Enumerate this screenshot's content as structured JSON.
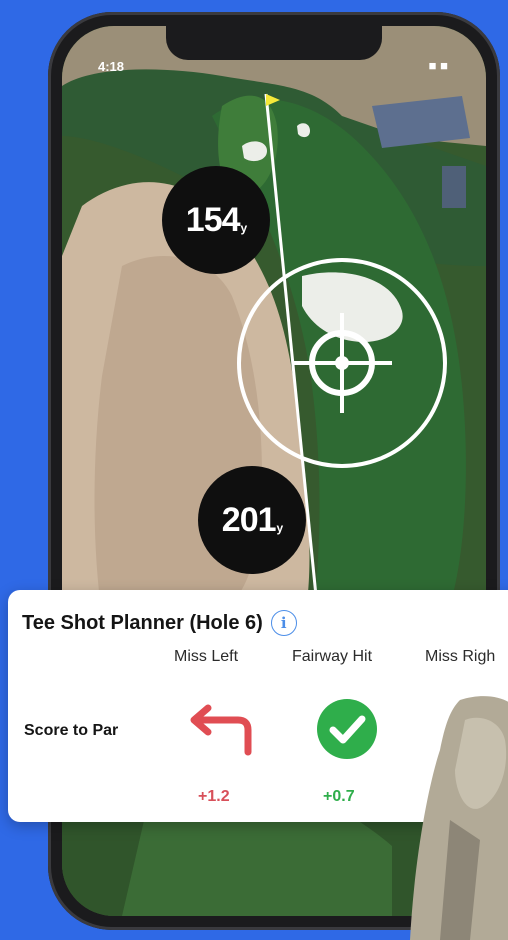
{
  "status_bar": {
    "time": "4:18",
    "icons": "■ ■"
  },
  "map": {
    "distances": [
      {
        "value": "154",
        "unit": "y"
      },
      {
        "value": "201",
        "unit": "y"
      }
    ]
  },
  "planner": {
    "title": "Tee Shot Planner (Hole 6)",
    "info_icon": "i",
    "columns": [
      "Miss Left",
      "Fairway Hit",
      "Miss Righ"
    ],
    "row_label": "Score to Par",
    "values": [
      "+1.2",
      "+0.7"
    ],
    "colors": {
      "miss_left": "#e04d53",
      "fairway": "#2fae4b",
      "miss_right": "#f4b42a",
      "info": "#4c8ee8"
    }
  }
}
